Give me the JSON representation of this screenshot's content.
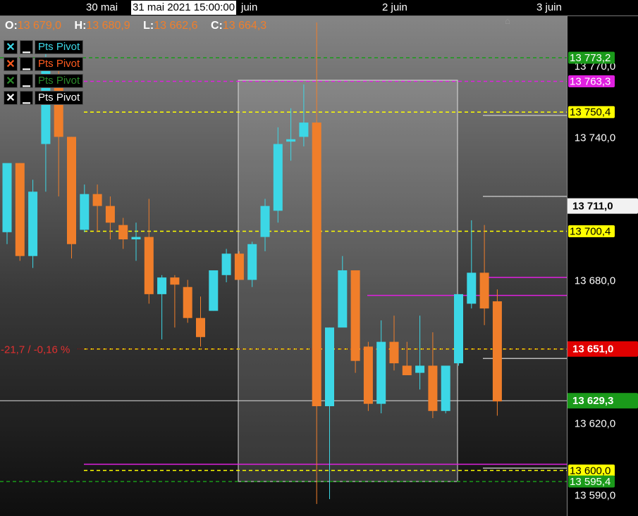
{
  "header": {
    "dates": [
      "30 mai",
      "2 juin",
      "3 juin"
    ],
    "cursor_date": "31 mai 2021 15:00:00",
    "hidden_date_tail": "juin"
  },
  "ohlc": {
    "open_label": "O:",
    "open": "13 679,0",
    "high_label": "H:",
    "high": "13 680,9",
    "low_label": "L:",
    "low": "13 662,6",
    "close_label": "C:",
    "close": "13 664,3"
  },
  "legend": [
    {
      "x": "✕",
      "label": "Pts Pivot",
      "color": "#3cd7e6"
    },
    {
      "x": "✕",
      "label": "Pts Pivot",
      "color": "#ff5b1f"
    },
    {
      "x": "✕",
      "label": "Pts Pivot",
      "color": "#2a8a2a"
    },
    {
      "x": "✕",
      "label": "Pts Pivot",
      "color": "#ffffff"
    }
  ],
  "colors": {
    "up": "#3cd7e6",
    "down": "#f07e2a",
    "pivot_yellow": "#ffff00",
    "pivot_green": "#1a9a1a",
    "pivot_magenta": "#e020e0",
    "alert_red": "#e00000"
  },
  "change_label": "-21,7 / -0,16 %",
  "chart_data": {
    "type": "candlestick",
    "y_axis_ticks": [
      "13 770,0",
      "13 740,0",
      "13 680,0",
      "13 620,0",
      "13 590,0"
    ],
    "y_range": [
      13585,
      13800
    ],
    "price_tags": [
      {
        "value": 13773.2,
        "text": "13 773,2",
        "bg": "#1a9a1a",
        "fg": "#ffffff"
      },
      {
        "value": 13763.3,
        "text": "13 763,3",
        "bg": "#e020e0",
        "fg": "#ffffff"
      },
      {
        "value": 13750.4,
        "text": "13 750,4",
        "bg": "#ffff00",
        "fg": "#000000"
      },
      {
        "value": 13711.0,
        "text": "13 711,0",
        "bg": "#f2f2f2",
        "fg": "#000000"
      },
      {
        "value": 13700.4,
        "text": "13 700,4",
        "bg": "#ffff00",
        "fg": "#000000"
      },
      {
        "value": 13651.0,
        "text": "13 651,0",
        "bg": "#e00000",
        "fg": "#ffffff"
      },
      {
        "value": 13629.3,
        "text": "13 629,3",
        "bg": "#1a9a1a",
        "fg": "#ffffff"
      },
      {
        "value": 13600.0,
        "text": "13 600,0",
        "bg": "#ffff00",
        "fg": "#000000"
      },
      {
        "value": 13595.4,
        "text": "13 595,4",
        "bg": "#1a9a1a",
        "fg": "#ffffff"
      }
    ],
    "candles": [
      {
        "o": 13700,
        "h": 13725,
        "l": 13695,
        "c": 13729
      },
      {
        "o": 13729,
        "h": 13729,
        "l": 13688,
        "c": 13690
      },
      {
        "o": 13690,
        "h": 13722,
        "l": 13685,
        "c": 13717
      },
      {
        "o": 13737,
        "h": 13778,
        "l": 13717,
        "c": 13768
      },
      {
        "o": 13762,
        "h": 13768,
        "l": 13715,
        "c": 13740
      },
      {
        "o": 13740,
        "h": 13740,
        "l": 13689,
        "c": 13695
      },
      {
        "o": 13701,
        "h": 13720,
        "l": 13700,
        "c": 13716
      },
      {
        "o": 13716,
        "h": 13720,
        "l": 13700,
        "c": 13711
      },
      {
        "o": 13711,
        "h": 13715,
        "l": 13697,
        "c": 13704
      },
      {
        "o": 13703,
        "h": 13706,
        "l": 13693,
        "c": 13697
      },
      {
        "o": 13697,
        "h": 13704,
        "l": 13688,
        "c": 13698
      },
      {
        "o": 13698,
        "h": 13714,
        "l": 13670,
        "c": 13674
      },
      {
        "o": 13674,
        "h": 13682,
        "l": 13655,
        "c": 13681
      },
      {
        "o": 13681,
        "h": 13682,
        "l": 13660,
        "c": 13678
      },
      {
        "o": 13677,
        "h": 13680,
        "l": 13662,
        "c": 13664
      },
      {
        "o": 13664,
        "h": 13673,
        "l": 13652,
        "c": 13656
      },
      {
        "o": 13667,
        "h": 13684,
        "l": 13667,
        "c": 13684
      },
      {
        "o": 13682,
        "h": 13693,
        "l": 13679,
        "c": 13691
      },
      {
        "o": 13691,
        "h": 13692,
        "l": 13680,
        "c": 13680
      },
      {
        "o": 13680,
        "h": 13696,
        "l": 13677,
        "c": 13695
      },
      {
        "o": 13698,
        "h": 13714,
        "l": 13692,
        "c": 13711
      },
      {
        "o": 13709,
        "h": 13744,
        "l": 13704,
        "c": 13737
      },
      {
        "o": 13738,
        "h": 13752,
        "l": 13730,
        "c": 13739
      },
      {
        "o": 13740,
        "h": 13762,
        "l": 13736,
        "c": 13746
      },
      {
        "o": 13746,
        "h": 13788,
        "l": 13586,
        "c": 13627
      },
      {
        "o": 13627,
        "h": 13660,
        "l": 13588,
        "c": 13660
      },
      {
        "o": 13660,
        "h": 13690,
        "l": 13661,
        "c": 13684
      },
      {
        "o": 13684,
        "h": 13684,
        "l": 13641,
        "c": 13646
      },
      {
        "o": 13652,
        "h": 13654,
        "l": 13625,
        "c": 13628
      },
      {
        "o": 13628,
        "h": 13663,
        "l": 13624,
        "c": 13654
      },
      {
        "o": 13654,
        "h": 13665,
        "l": 13642,
        "c": 13645
      },
      {
        "o": 13644,
        "h": 13654,
        "l": 13640,
        "c": 13640
      },
      {
        "o": 13641,
        "h": 13665,
        "l": 13634,
        "c": 13644
      },
      {
        "o": 13644,
        "h": 13658,
        "l": 13622,
        "c": 13625
      },
      {
        "o": 13625,
        "h": 13643,
        "l": 13624,
        "c": 13644
      },
      {
        "o": 13645,
        "h": 13674,
        "l": 13644,
        "c": 13674
      },
      {
        "o": 13670,
        "h": 13705,
        "l": 13668,
        "c": 13683
      },
      {
        "o": 13683,
        "h": 13703,
        "l": 13661,
        "c": 13668
      },
      {
        "o": 13671,
        "h": 13676,
        "l": 13623,
        "c": 13629
      }
    ],
    "pivot_lines": [
      {
        "y": 13773.2,
        "color": "#1a9a1a",
        "style": "dashed"
      },
      {
        "y": 13763.3,
        "color": "#e020e0",
        "style": "dashed"
      },
      {
        "y": 13750.4,
        "color": "#ffff00",
        "style": "dashed"
      },
      {
        "y": 13700.4,
        "color": "#ffff00",
        "style": "dashed"
      },
      {
        "y": 13651.0,
        "color": "#ffff00",
        "style": "dashed"
      },
      {
        "y": 13600.0,
        "color": "#ffff00",
        "style": "dashed"
      },
      {
        "y": 13595.4,
        "color": "#1a9a1a",
        "style": "dashed"
      }
    ]
  }
}
